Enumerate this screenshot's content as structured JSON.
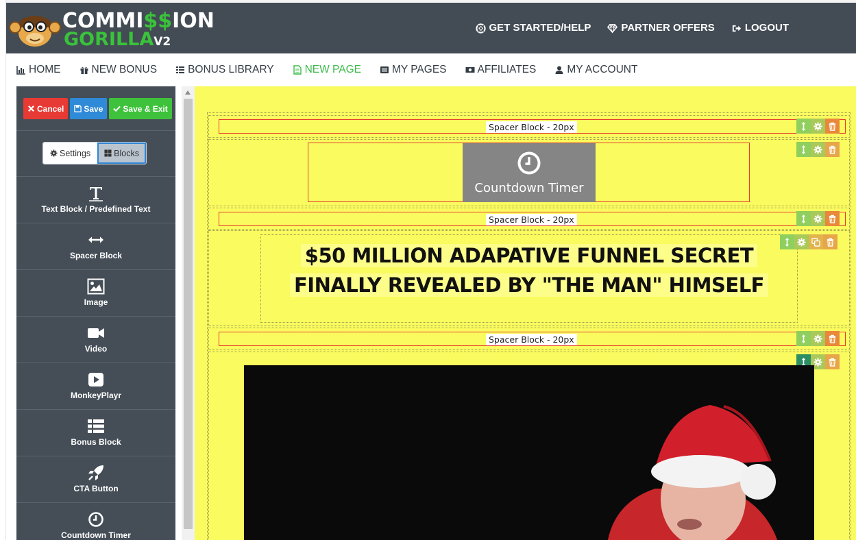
{
  "brand": {
    "line1_start": "COMMI",
    "line1_money": "$$",
    "line1_end": "ION",
    "line2": "GORILLA",
    "version": "V2"
  },
  "top_nav": [
    {
      "label": "GET STARTED/HELP",
      "icon": "lifebuoy-icon"
    },
    {
      "label": "PARTNER OFFERS",
      "icon": "diamond-icon"
    },
    {
      "label": "LOGOUT",
      "icon": "sign-out-icon"
    }
  ],
  "sub_nav": [
    {
      "label": "HOME",
      "icon": "bar-chart-icon"
    },
    {
      "label": "NEW BONUS",
      "icon": "gift-icon"
    },
    {
      "label": "BONUS LIBRARY",
      "icon": "list-icon"
    },
    {
      "label": "NEW PAGE",
      "icon": "file-text-icon",
      "active": true
    },
    {
      "label": "MY PAGES",
      "icon": "list-alt-icon"
    },
    {
      "label": "AFFILIATES",
      "icon": "money-icon"
    },
    {
      "label": "MY ACCOUNT",
      "icon": "user-icon"
    }
  ],
  "sidebar": {
    "cancel": "Cancel",
    "save": "Save",
    "save_exit": "Save & Exit",
    "tab_settings": "Settings",
    "tab_blocks": "Blocks",
    "items": [
      {
        "label": "Text Block / Predefined Text",
        "icon": "text-icon"
      },
      {
        "label": "Spacer Block",
        "icon": "arrows-h-icon"
      },
      {
        "label": "Image",
        "icon": "image-icon"
      },
      {
        "label": "Video",
        "icon": "video-camera-icon"
      },
      {
        "label": "MonkeyPlayr",
        "icon": "play-icon"
      },
      {
        "label": "Bonus Block",
        "icon": "list-icon"
      },
      {
        "label": "CTA Button",
        "icon": "rocket-icon"
      },
      {
        "label": "Countdown Timer",
        "icon": "clock-icon"
      }
    ]
  },
  "canvas": {
    "spacer_label": "Spacer Block - 20px",
    "timer_label": "Countdown Timer",
    "headline_line1": "$50 MILLION ADAPATIVE FUNNEL SECRET",
    "headline_line2": "FINALLY REVEALED BY \"THE MAN\" HIMSELF",
    "background_color": "#fafb5e"
  },
  "colors": {
    "header": "#434c55",
    "sidebar": "#454e57",
    "accent_green": "#3dbb4a",
    "cancel_red": "#e83a34",
    "save_blue": "#2f8ad8"
  }
}
